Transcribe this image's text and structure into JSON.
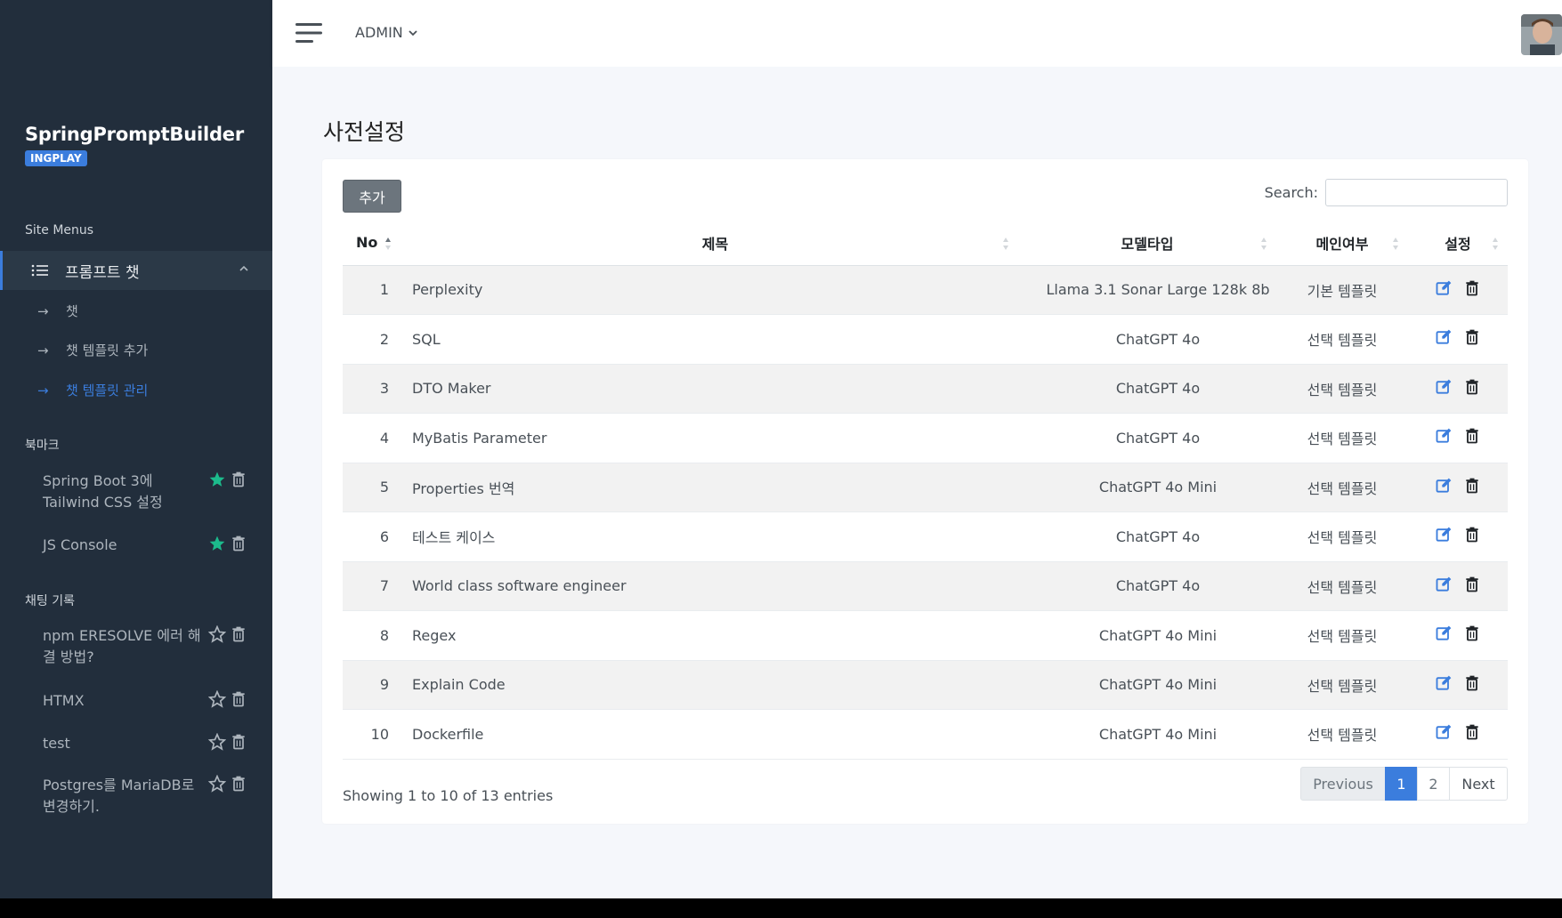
{
  "sidebar": {
    "brand_title": "SpringPromptBuilder",
    "brand_badge": "INGPLAY",
    "site_menus_title": "Site Menus",
    "active_menu": "프롬프트 챗",
    "submenus": [
      {
        "label": "챗",
        "active": false
      },
      {
        "label": "챗 템플릿 추가",
        "active": false
      },
      {
        "label": "챗 템플릿 관리",
        "active": true
      }
    ],
    "bookmarks_title": "북마크",
    "bookmarks": [
      {
        "label": "Spring Boot 3에 Tailwind CSS 설정",
        "starred": true
      },
      {
        "label": "JS Console",
        "starred": true
      }
    ],
    "history_title": "채팅 기록",
    "history": [
      {
        "label": "npm ERESOLVE 에러 해결 방법?",
        "starred": false
      },
      {
        "label": "HTMX",
        "starred": false
      },
      {
        "label": "test",
        "starred": false
      },
      {
        "label": "Postgres를 MariaDB로 변경하기.",
        "starred": false
      }
    ]
  },
  "topbar": {
    "user_menu": "ADMIN"
  },
  "main": {
    "page_title": "사전설정",
    "add_button": "추가",
    "search_label": "Search:",
    "search_value": "",
    "columns": [
      "No",
      "제목",
      "모델타입",
      "메인여부",
      "설정"
    ],
    "rows": [
      {
        "no": "1",
        "title": "Perplexity",
        "model": "Llama 3.1 Sonar Large 128k 8b",
        "main": "기본 템플릿"
      },
      {
        "no": "2",
        "title": "SQL",
        "model": "ChatGPT 4o",
        "main": "선택 템플릿"
      },
      {
        "no": "3",
        "title": "DTO Maker",
        "model": "ChatGPT 4o",
        "main": "선택 템플릿"
      },
      {
        "no": "4",
        "title": "MyBatis Parameter",
        "model": "ChatGPT 4o",
        "main": "선택 템플릿"
      },
      {
        "no": "5",
        "title": "Properties 번역",
        "model": "ChatGPT 4o Mini",
        "main": "선택 템플릿"
      },
      {
        "no": "6",
        "title": "테스트 케이스",
        "model": "ChatGPT 4o",
        "main": "선택 템플릿"
      },
      {
        "no": "7",
        "title": "World class software engineer",
        "model": "ChatGPT 4o",
        "main": "선택 템플릿"
      },
      {
        "no": "8",
        "title": "Regex",
        "model": "ChatGPT 4o Mini",
        "main": "선택 템플릿"
      },
      {
        "no": "9",
        "title": "Explain Code",
        "model": "ChatGPT 4o Mini",
        "main": "선택 템플릿"
      },
      {
        "no": "10",
        "title": "Dockerfile",
        "model": "ChatGPT 4o Mini",
        "main": "선택 템플릿"
      }
    ],
    "info": "Showing 1 to 10 of 13 entries",
    "pagination": {
      "previous": "Previous",
      "page1": "1",
      "page2": "2",
      "next": "Next"
    }
  },
  "colors": {
    "sidebar_bg": "#222e3c",
    "accent": "#3b7ddd",
    "star_filled": "#1cbb8c"
  },
  "icons": {
    "menu": "list-icon",
    "hamburger": "hamburger-icon",
    "edit": "edit-icon",
    "delete": "trash-icon",
    "bookmark": "star-icon"
  }
}
